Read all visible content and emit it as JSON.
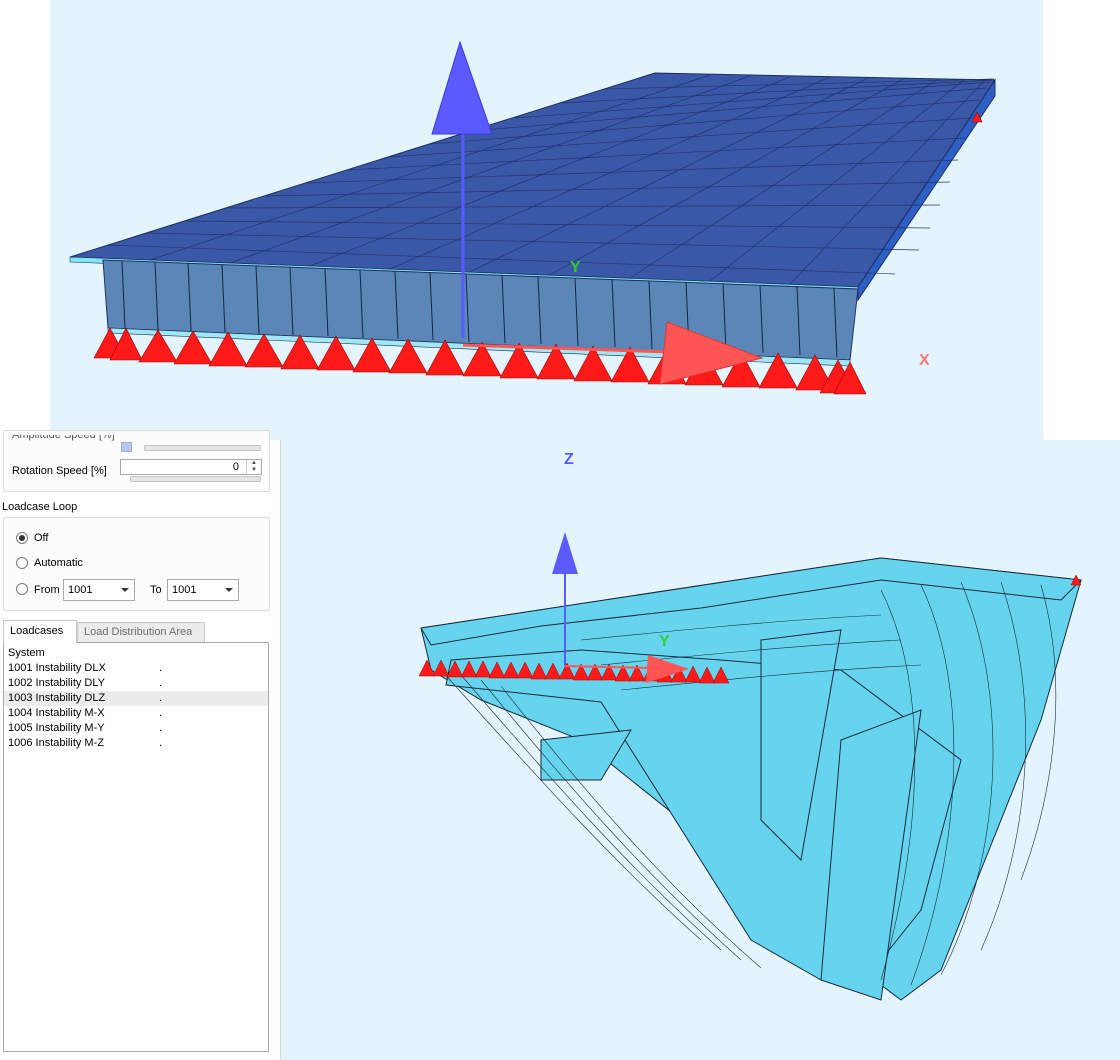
{
  "viewport_top": {
    "axis_labels": {
      "x": "X",
      "y": "Y",
      "z": "Z"
    }
  },
  "viewport_bottom": {
    "axis_labels": {
      "y": "Y"
    }
  },
  "animation": {
    "amplitude_label": "Amplitude Speed [%]",
    "rotation_label": "Rotation Speed [%]",
    "rotation_value": "0"
  },
  "loadcase_loop": {
    "title": "Loadcase Loop",
    "off_label": "Off",
    "automatic_label": "Automatic",
    "from_label": "From",
    "from_value": "1001",
    "to_label": "To",
    "to_value": "1001",
    "selected": "Off"
  },
  "tabs": [
    {
      "label": "Loadcases",
      "active": true
    },
    {
      "label": "Load Distribution Area",
      "active": false
    }
  ],
  "loadcases": [
    {
      "name": "System",
      "marker": ""
    },
    {
      "name": "1001 Instability DLX",
      "marker": "."
    },
    {
      "name": "1002 Instability DLY",
      "marker": "."
    },
    {
      "name": "1003 Instability DLZ",
      "marker": "."
    },
    {
      "name": "1004 Instability M-X",
      "marker": "."
    },
    {
      "name": "1005 Instability M-Y",
      "marker": "."
    },
    {
      "name": "1006 Instability M-Z",
      "marker": "."
    }
  ],
  "colors": {
    "viewport_bg": "#e3f4fd",
    "deck_top": "#3a58a8",
    "deck_web": "#5b86b8",
    "support_red": "#ff1a1a",
    "axis_blue": "#5a5aff",
    "axis_red": "#ff5555",
    "axis_green": "#33cc33",
    "deformed_fill": "#66d4ef"
  }
}
